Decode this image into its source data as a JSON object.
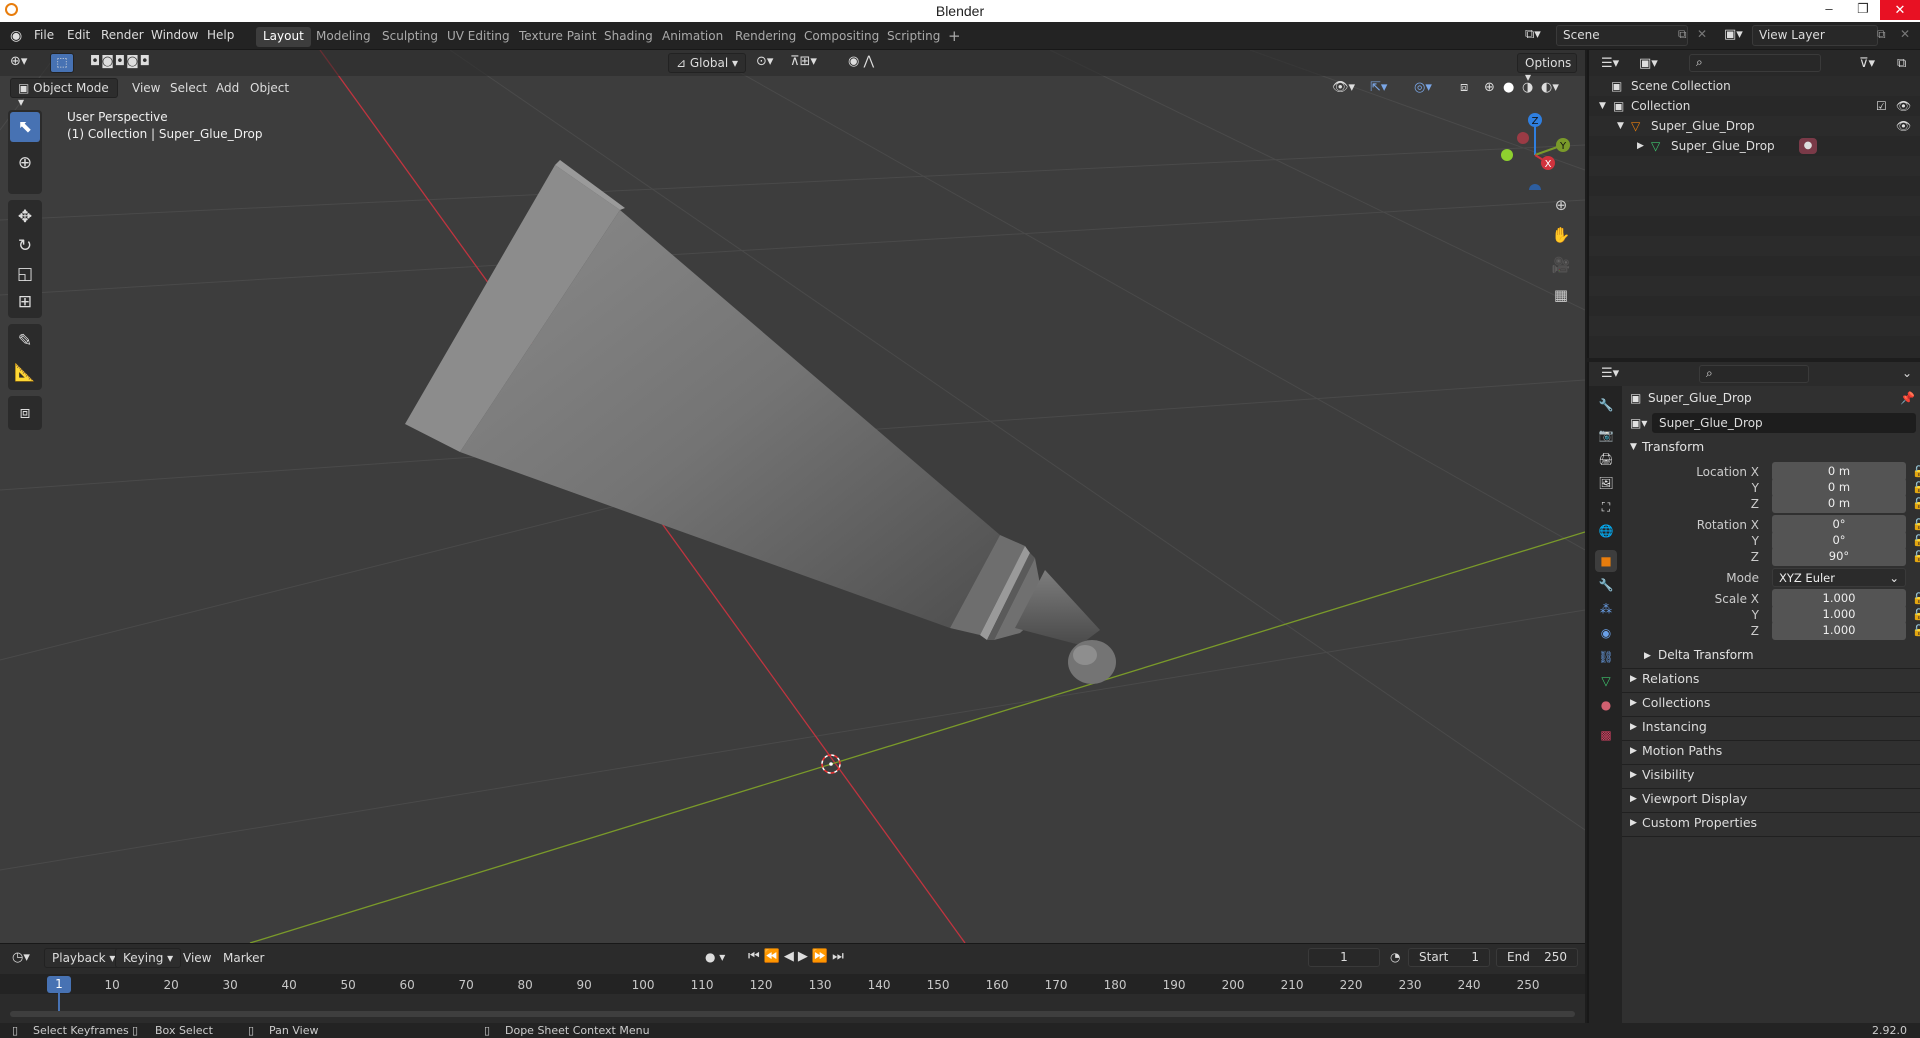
{
  "window": {
    "title": "Blender",
    "version": "2.92.0"
  },
  "menus": [
    "File",
    "Edit",
    "Render",
    "Window",
    "Help"
  ],
  "workspaces": [
    "Layout",
    "Modeling",
    "Sculpting",
    "UV Editing",
    "Texture Paint",
    "Shading",
    "Animation",
    "Rendering",
    "Compositing",
    "Scripting"
  ],
  "active_workspace": "Layout",
  "scene": {
    "name": "Scene",
    "view_layer": "View Layer"
  },
  "viewport": {
    "mode": "Object Mode",
    "menus": [
      "View",
      "Select",
      "Add",
      "Object"
    ],
    "transform_orientation": "Global",
    "options_label": "Options",
    "overlay_title": "User Perspective",
    "overlay_subtitle": "(1) Collection | Super_Glue_Drop",
    "gizmo_axes": [
      "Z",
      "Y",
      "X"
    ]
  },
  "outliner": {
    "items": [
      {
        "label": "Scene Collection"
      },
      {
        "label": "Collection"
      },
      {
        "label": "Super_Glue_Drop"
      },
      {
        "label": "Super_Glue_Drop"
      }
    ]
  },
  "properties": {
    "object_name": "Super_Glue_Drop",
    "name_field": "Super_Glue_Drop",
    "transform_title": "Transform",
    "location": {
      "label": "Location X",
      "x": "0 m",
      "y": "0 m",
      "z": "0 m"
    },
    "rotation": {
      "label": "Rotation X",
      "x": "0°",
      "y": "0°",
      "z": "90°"
    },
    "mode_label": "Mode",
    "mode_value": "XYZ Euler",
    "scale": {
      "label": "Scale X",
      "x": "1.000",
      "y": "1.000",
      "z": "1.000"
    },
    "axis_y": "Y",
    "axis_z": "Z",
    "delta": "Delta Transform",
    "sections": [
      "Relations",
      "Collections",
      "Instancing",
      "Motion Paths",
      "Visibility",
      "Viewport Display",
      "Custom Properties"
    ]
  },
  "timeline": {
    "menus": [
      "Playback",
      "Keying",
      "View",
      "Marker"
    ],
    "current_frame": "1",
    "start_label": "Start",
    "start": "1",
    "end_label": "End",
    "end": "250",
    "ticks": [
      "1",
      "10",
      "20",
      "30",
      "40",
      "50",
      "60",
      "70",
      "80",
      "90",
      "100",
      "110",
      "120",
      "130",
      "140",
      "150",
      "160",
      "170",
      "180",
      "190",
      "200",
      "210",
      "220",
      "230",
      "240",
      "250"
    ]
  },
  "statusbar": [
    "Select Keyframes",
    "Box Select",
    "Pan View",
    "Dope Sheet Context Menu"
  ],
  "colors": {
    "accent": "#4772b3",
    "x_axis": "#d0333d",
    "y_axis": "#7a9a2a",
    "z_axis": "#2f7fe0",
    "object_orange": "#e87d0d"
  }
}
